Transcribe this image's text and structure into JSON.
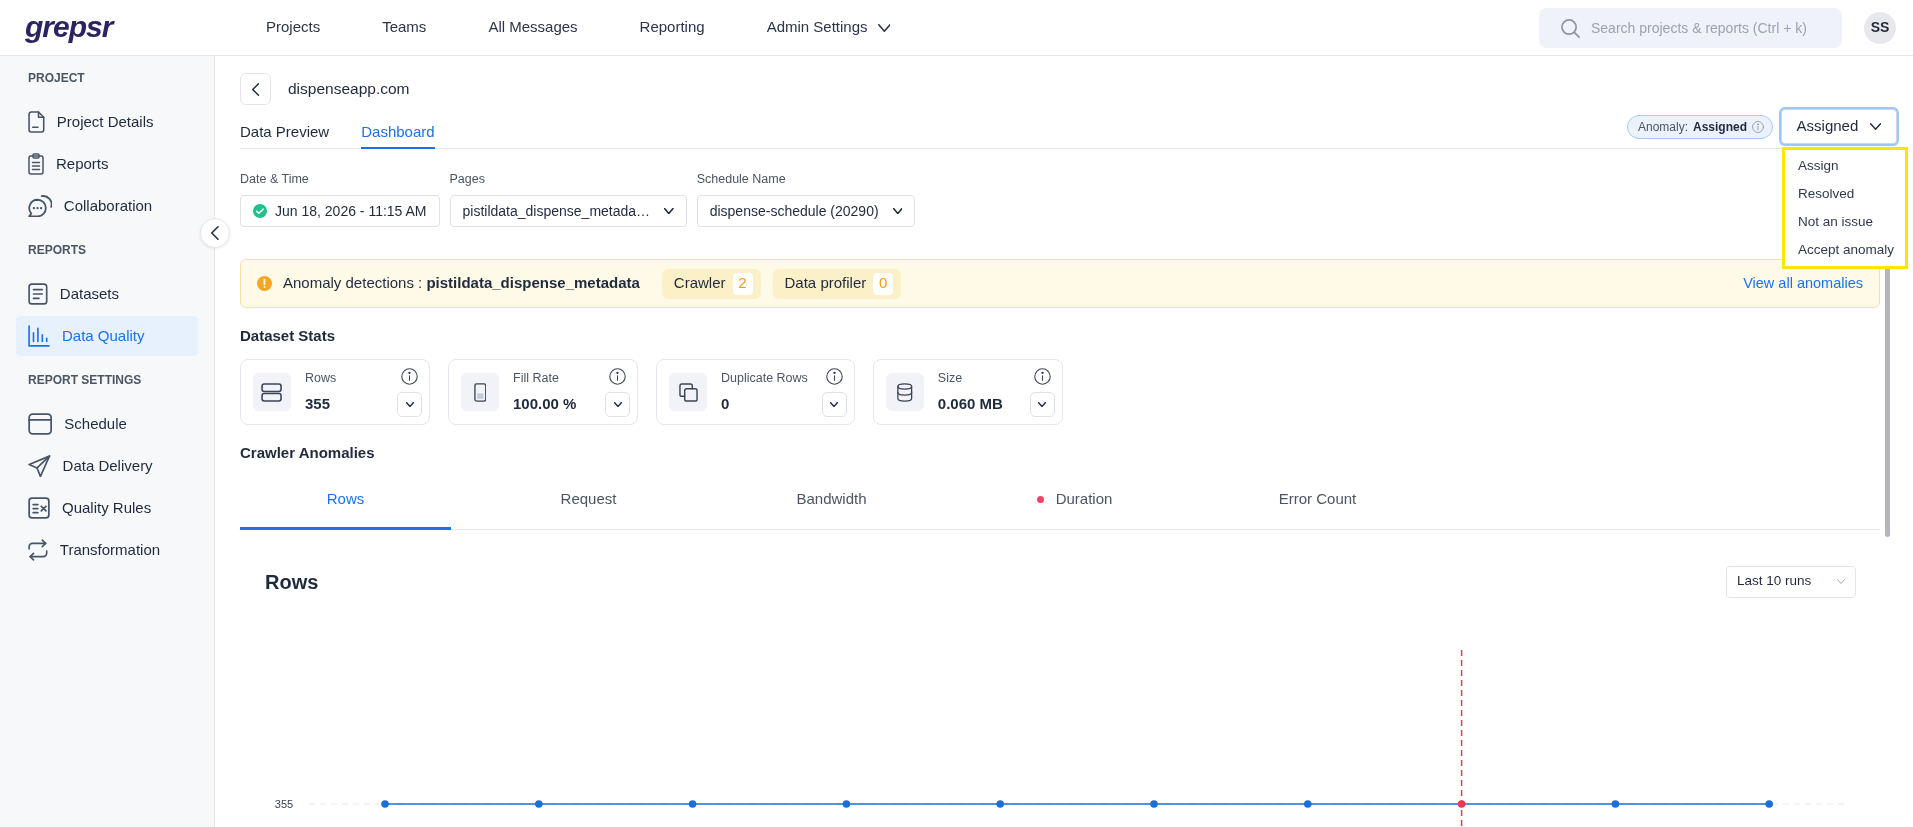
{
  "app": {
    "logo": "grepsr"
  },
  "top_nav": {
    "items": [
      {
        "label": "Projects",
        "kind": "link"
      },
      {
        "label": "Teams",
        "kind": "link"
      },
      {
        "label": "All Messages",
        "kind": "link"
      },
      {
        "label": "Reporting",
        "kind": "link"
      },
      {
        "label": "Admin Settings",
        "kind": "dropdown"
      }
    ],
    "search": {
      "placeholder": "Search projects & reports (Ctrl + k)"
    },
    "avatar": "SS"
  },
  "sidebar": {
    "sections": [
      {
        "title": "PROJECT",
        "items": [
          {
            "label": "Project Details",
            "selected": false
          },
          {
            "label": "Reports",
            "selected": false
          },
          {
            "label": "Collaboration",
            "selected": false
          }
        ]
      },
      {
        "title": "REPORTS",
        "items": [
          {
            "label": "Datasets",
            "selected": false
          },
          {
            "label": "Data Quality",
            "selected": true
          }
        ]
      },
      {
        "title": "REPORT SETTINGS",
        "items": [
          {
            "label": "Schedule",
            "selected": false
          },
          {
            "label": "Data Delivery",
            "selected": false
          },
          {
            "label": "Quality Rules",
            "selected": false
          },
          {
            "label": "Transformation",
            "selected": false
          }
        ]
      }
    ]
  },
  "page": {
    "title": "dispenseapp.com",
    "tabs": [
      {
        "label": "Data Preview",
        "selected": false
      },
      {
        "label": "Dashboard",
        "selected": true
      }
    ],
    "anomaly_status": {
      "label": "Anomaly:",
      "value": "Assigned"
    },
    "status_dropdown": {
      "value": "Assigned",
      "expanded": true,
      "options": [
        "Assign",
        "Resolved",
        "Not an issue",
        "Accept anomaly"
      ]
    },
    "filters": [
      {
        "label": "Date & Time",
        "value": "Jun 18, 2026 - 11:15 AM",
        "kind": "date"
      },
      {
        "label": "Pages",
        "value": "pistildata_dispense_metada…",
        "kind": "select"
      },
      {
        "label": "Schedule Name",
        "value": "dispense-schedule (20290)",
        "kind": "select"
      }
    ],
    "anomaly_banner": {
      "text": "Anomaly detections : **pistildata_dispense_metadata**",
      "chips": [
        {
          "label": "Crawler",
          "count": "2"
        },
        {
          "label": "Data profiler",
          "count": "0"
        }
      ],
      "link": "View all anomalies"
    },
    "dataset_stats": {
      "title": "Dataset Stats",
      "cards": [
        {
          "label": "Rows",
          "value": "355"
        },
        {
          "label": "Fill Rate",
          "value": "100.00 %"
        },
        {
          "label": "Duplicate Rows",
          "value": "0"
        },
        {
          "label": "Size",
          "value": "0.060 MB"
        }
      ]
    },
    "crawler_anomalies": {
      "title": "Crawler Anomalies",
      "tabs": [
        {
          "label": "Rows",
          "selected": true,
          "alert": false
        },
        {
          "label": "Request",
          "selected": false,
          "alert": false
        },
        {
          "label": "Bandwidth",
          "selected": false,
          "alert": false
        },
        {
          "label": "Duration",
          "selected": false,
          "alert": true
        },
        {
          "label": "Error Count",
          "selected": false,
          "alert": false
        }
      ]
    },
    "chart_panel": {
      "title": "Rows",
      "range": "Last 10 runs",
      "y_axis_label": "355",
      "points": [
        {
          "anomaly": false
        },
        {
          "anomaly": false
        },
        {
          "anomaly": false
        },
        {
          "anomaly": false
        },
        {
          "anomaly": false
        },
        {
          "anomaly": false
        },
        {
          "anomaly": false
        },
        {
          "anomaly": true
        },
        {
          "anomaly": false
        },
        {
          "anomaly": false
        }
      ]
    }
  }
}
